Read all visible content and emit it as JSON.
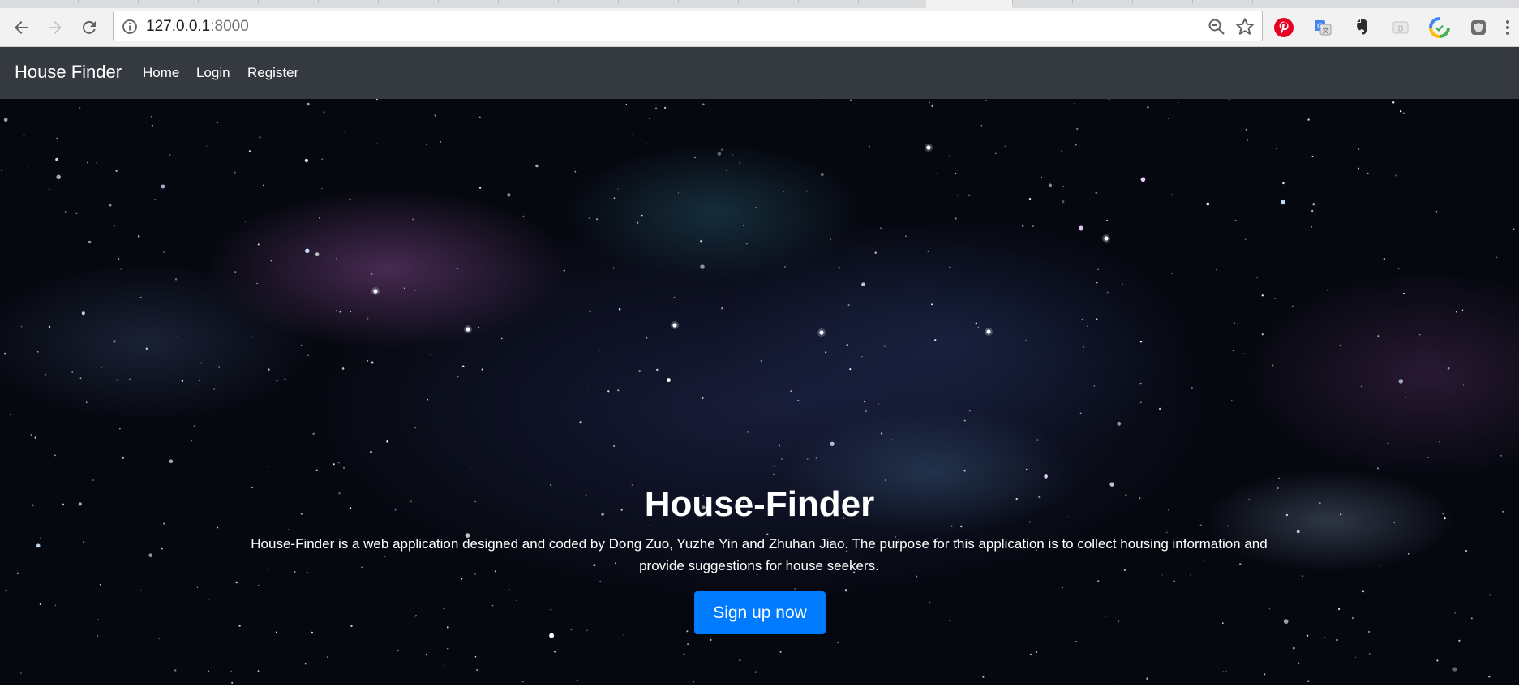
{
  "browser": {
    "url_host": "127.0.0.1",
    "url_port": ":8000"
  },
  "site": {
    "brand": "House Finder",
    "nav": [
      {
        "label": "Home"
      },
      {
        "label": "Login"
      },
      {
        "label": "Register"
      }
    ]
  },
  "hero": {
    "title": "House-Finder",
    "description": "House-Finder is a web application designed and coded by Dong Zuo, Yuzhe Yin and Zhuhan Jiao. The purpose for this application is to collect housing information and provide suggestions for house seekers.",
    "cta_label": "Sign up now"
  },
  "colors": {
    "navbar": "#343a40",
    "cta": "#007bff",
    "pinterest": "#e60023",
    "evernote": "#2e2e2e"
  },
  "icons": {
    "back": "arrow-left-icon",
    "forward": "arrow-right-icon",
    "reload": "reload-icon",
    "info": "info-icon",
    "zoom": "zoom-out-icon",
    "bookmark": "star-icon",
    "menu": "kebab-menu-icon"
  }
}
